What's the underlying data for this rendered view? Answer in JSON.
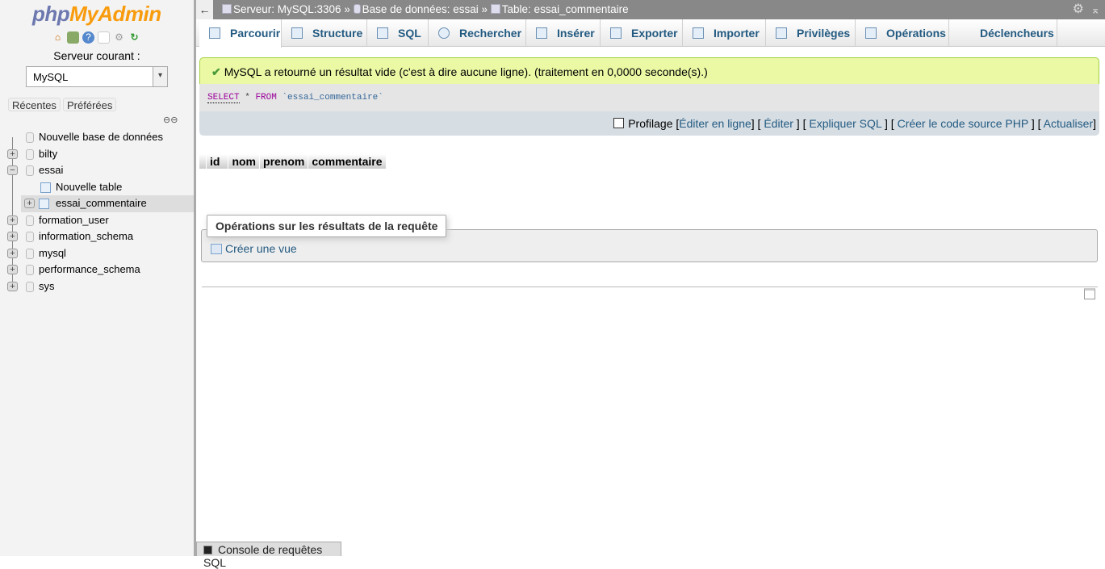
{
  "sidebar": {
    "logo": {
      "part1": "php",
      "part2": "MyAdmin"
    },
    "icons": [
      "home-icon",
      "logout-icon",
      "help-icon",
      "docs-icon",
      "settings-icon",
      "reload-icon"
    ],
    "server_label": "Serveur courant :",
    "server_select": "MySQL",
    "recent": "Récentes",
    "favorites": "Préférées",
    "tree": {
      "new_db": "Nouvelle base de données",
      "dbs": [
        "bilty",
        "essai",
        "formation_user",
        "information_schema",
        "mysql",
        "performance_schema",
        "sys"
      ],
      "new_table": "Nouvelle table",
      "table": "essai_commentaire"
    }
  },
  "topbar": {
    "back": "←",
    "server": "Serveur: MySQL:3306",
    "sep": "»",
    "database": "Base de données: essai",
    "table": "Table: essai_commentaire"
  },
  "tabs": [
    "Parcourir",
    "Structure",
    "SQL",
    "Rechercher",
    "Insérer",
    "Exporter",
    "Importer",
    "Privilèges",
    "Opérations",
    "Déclencheurs"
  ],
  "active_tab": "Parcourir",
  "message": "MySQL a retourné un résultat vide (c'est à dire aucune ligne). (traitement en 0,0000 seconde(s).)",
  "sql": {
    "select": "SELECT",
    "star": "*",
    "from": "FROM",
    "table": "`essai_commentaire`"
  },
  "toolbar": {
    "profiling": "Profilage",
    "edit_inline": "Éditer en ligne",
    "edit": "Éditer",
    "explain": "Expliquer SQL",
    "php": "Créer le code source PHP",
    "refresh": "Actualiser"
  },
  "columns": [
    "id",
    "nom",
    "prenom",
    "commentaire"
  ],
  "operations": {
    "legend": "Opérations sur les résultats de la requête",
    "create_view": "Créer une vue"
  },
  "console": "Console de requêtes SQL"
}
